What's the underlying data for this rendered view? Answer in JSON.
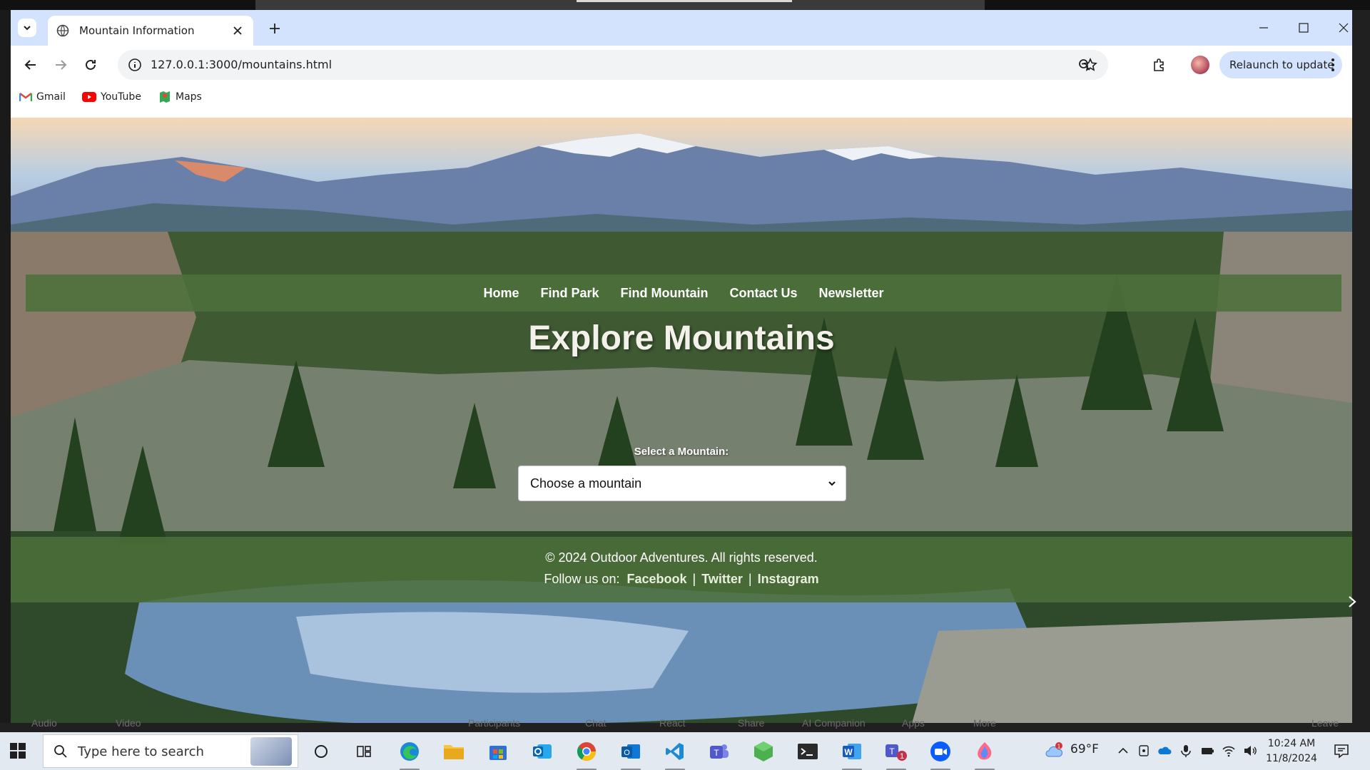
{
  "browser": {
    "tab_title": "Mountain Information",
    "url": "127.0.0.1:3000/mountains.html",
    "relaunch_label": "Relaunch to update",
    "bookmarks": [
      "Gmail",
      "YouTube",
      "Maps"
    ]
  },
  "page": {
    "nav": [
      "Home",
      "Find Park",
      "Find Mountain",
      "Contact Us",
      "Newsletter"
    ],
    "title": "Explore Mountains",
    "select_label": "Select a Mountain:",
    "select_value": "Choose a mountain",
    "footer_copy": "© 2024 Outdoor Adventures. All rights reserved.",
    "follow_label": "Follow us on:",
    "social": [
      "Facebook",
      "Twitter",
      "Instagram"
    ],
    "separator": "|"
  },
  "zoom_bar": [
    "Audio",
    "Video",
    "Participants",
    "Chat",
    "React",
    "Share",
    "AI Companion",
    "Apps",
    "More",
    "Leave"
  ],
  "taskbar": {
    "search_placeholder": "Type here to search",
    "weather": "69°F",
    "time": "10:24 AM",
    "date": "11/8/2024",
    "weather_badge": "1",
    "teams_badge": "1"
  },
  "colors": {
    "nav_bg": "#4c703a",
    "tab_strip": "#d3e3fd"
  }
}
